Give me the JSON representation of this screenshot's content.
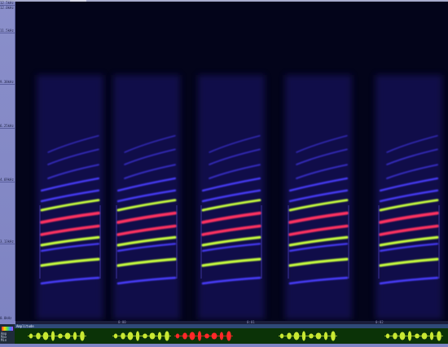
{
  "ruler": {
    "ticks": [
      "12.5kHz",
      "12.0kHz",
      "11.5kHz",
      "9.38kHz",
      "6.25kHz",
      "4.69kHz",
      "3.13kHz",
      "0.0kHz"
    ]
  },
  "bottom_scale": {
    "ticks": [
      "0:00",
      "0:01",
      "0:02"
    ]
  },
  "amplitude_panel": {
    "title": "Amplitude",
    "side_labels": [
      "Amp",
      "Max",
      "Min"
    ]
  },
  "colors": {
    "spectrogram_background": "#03041a",
    "harmonic_low": "#4a3cff",
    "harmonic_mid": "#c8ff3c",
    "harmonic_high": "#ff3060",
    "waveform_normal": "#c8e832",
    "waveform_selected": "#ff2828"
  },
  "waveform": {
    "selected_index": 2
  }
}
